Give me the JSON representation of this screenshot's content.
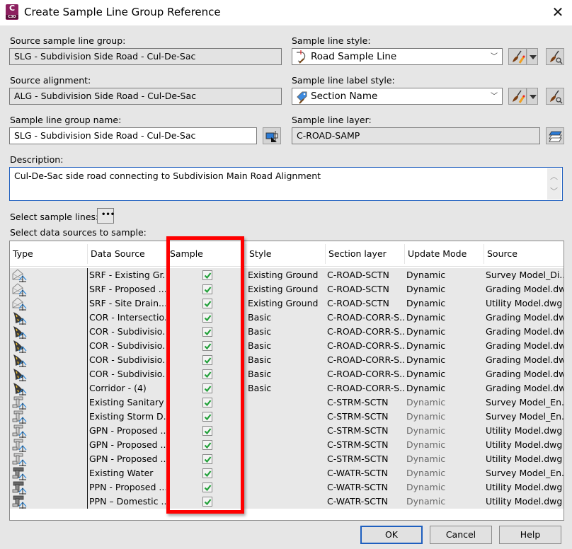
{
  "window": {
    "title": "Create Sample Line Group Reference",
    "app_icon_letter": "C",
    "app_icon_sub": "C3D",
    "close_glyph": "✕"
  },
  "form": {
    "source_group": {
      "label": "Source sample line group:",
      "value": "SLG - Subdivision Side Road - Cul-De-Sac"
    },
    "source_alignment": {
      "label": "Source alignment:",
      "value": "ALG - Subdivision Side Road - Cul-De-Sac"
    },
    "group_name": {
      "label": "Sample line group name:",
      "value": "SLG - Subdivision Side Road - Cul-De-Sac"
    },
    "line_style": {
      "label": "Sample line style:",
      "value": "Road Sample Line"
    },
    "label_style": {
      "label": "Sample line label style:",
      "value": "Section Name"
    },
    "layer": {
      "label": "Sample line layer:",
      "value": "C-ROAD-SAMP"
    },
    "description": {
      "label": "Description:",
      "value": "Cul-De-Sac side road connecting to Subdivision Main Road Alignment"
    },
    "select_lines_label": "Select sample lines:",
    "select_lines_button": "•••",
    "select_sources_label": "Select data sources to sample:"
  },
  "grid": {
    "columns": [
      "Type",
      "Data Source",
      "Sample",
      "Style",
      "Section layer",
      "Update Mode",
      "Source"
    ],
    "rows": [
      {
        "type": "surface",
        "data_source": "SRF - Existing Gr...",
        "sample": true,
        "style": "Existing Ground",
        "section_layer": "C-ROAD-SCTN",
        "update_mode": "Dynamic",
        "source": "Survey Model_Di...",
        "dim": false
      },
      {
        "type": "surface",
        "data_source": "SRF - Proposed ...",
        "sample": true,
        "style": "Existing Ground",
        "section_layer": "C-ROAD-SCTN",
        "update_mode": "Dynamic",
        "source": "Grading Model.dwg",
        "dim": false
      },
      {
        "type": "surface",
        "data_source": "SRF - Site Drain...",
        "sample": true,
        "style": "Existing Ground",
        "section_layer": "C-ROAD-SCTN",
        "update_mode": "Dynamic",
        "source": "Utility Model.dwg",
        "dim": false
      },
      {
        "type": "corridor",
        "data_source": "COR - Intersectio...",
        "sample": true,
        "style": "Basic",
        "section_layer": "C-ROAD-CORR-S...",
        "update_mode": "Dynamic",
        "source": "Grading Model.dwg",
        "dim": false
      },
      {
        "type": "corridor",
        "data_source": "COR - Subdivisio...",
        "sample": true,
        "style": "Basic",
        "section_layer": "C-ROAD-CORR-S...",
        "update_mode": "Dynamic",
        "source": "Grading Model.dwg",
        "dim": false
      },
      {
        "type": "corridor",
        "data_source": "COR - Subdivisio...",
        "sample": true,
        "style": "Basic",
        "section_layer": "C-ROAD-CORR-S...",
        "update_mode": "Dynamic",
        "source": "Grading Model.dwg",
        "dim": false
      },
      {
        "type": "corridor",
        "data_source": "COR - Subdivisio...",
        "sample": true,
        "style": "Basic",
        "section_layer": "C-ROAD-CORR-S...",
        "update_mode": "Dynamic",
        "source": "Grading Model.dwg",
        "dim": false
      },
      {
        "type": "corridor",
        "data_source": "COR - Subdivisio...",
        "sample": true,
        "style": "Basic",
        "section_layer": "C-ROAD-CORR-S...",
        "update_mode": "Dynamic",
        "source": "Grading Model.dwg",
        "dim": false
      },
      {
        "type": "corridor",
        "data_source": "Corridor - (4)",
        "sample": true,
        "style": "Basic",
        "section_layer": "C-ROAD-CORR-S...",
        "update_mode": "Dynamic",
        "source": "Grading Model.dwg",
        "dim": false
      },
      {
        "type": "gravity-pipe",
        "data_source": "Existing Sanitary ...",
        "sample": true,
        "style": "",
        "section_layer": "C-STRM-SCTN",
        "update_mode": "Dynamic",
        "source": "Survey Model_En...",
        "dim": true
      },
      {
        "type": "gravity-pipe",
        "data_source": "Existing Storm D...",
        "sample": true,
        "style": "",
        "section_layer": "C-STRM-SCTN",
        "update_mode": "Dynamic",
        "source": "Survey Model_En...",
        "dim": true
      },
      {
        "type": "gravity-pipe",
        "data_source": "GPN - Proposed ...",
        "sample": true,
        "style": "",
        "section_layer": "C-STRM-SCTN",
        "update_mode": "Dynamic",
        "source": "Utility Model.dwg",
        "dim": true
      },
      {
        "type": "gravity-pipe",
        "data_source": "GPN - Proposed ...",
        "sample": true,
        "style": "",
        "section_layer": "C-STRM-SCTN",
        "update_mode": "Dynamic",
        "source": "Utility Model.dwg",
        "dim": true
      },
      {
        "type": "gravity-pipe",
        "data_source": "GPN - Proposed ...",
        "sample": true,
        "style": "",
        "section_layer": "C-STRM-SCTN",
        "update_mode": "Dynamic",
        "source": "Utility Model.dwg",
        "dim": true
      },
      {
        "type": "pressure-pipe",
        "data_source": "Existing Water",
        "sample": true,
        "style": "",
        "section_layer": "C-WATR-SCTN",
        "update_mode": "Dynamic",
        "source": "Survey Model_En...",
        "dim": true
      },
      {
        "type": "pressure-pipe",
        "data_source": "PPN - Proposed ...",
        "sample": true,
        "style": "",
        "section_layer": "C-WATR-SCTN",
        "update_mode": "Dynamic",
        "source": "Utility Model.dwg",
        "dim": true
      },
      {
        "type": "pressure-pipe",
        "data_source": "PPN – Domestic ...",
        "sample": true,
        "style": "",
        "section_layer": "C-WATR-SCTN",
        "update_mode": "Dynamic",
        "source": "Utility Model.dwg",
        "dim": true
      }
    ]
  },
  "buttons": {
    "ok": "OK",
    "cancel": "Cancel",
    "help": "Help"
  },
  "colors": {
    "highlight": "#ff0000",
    "check": "#22a03a",
    "default_button_border": "#1e5fbf"
  }
}
